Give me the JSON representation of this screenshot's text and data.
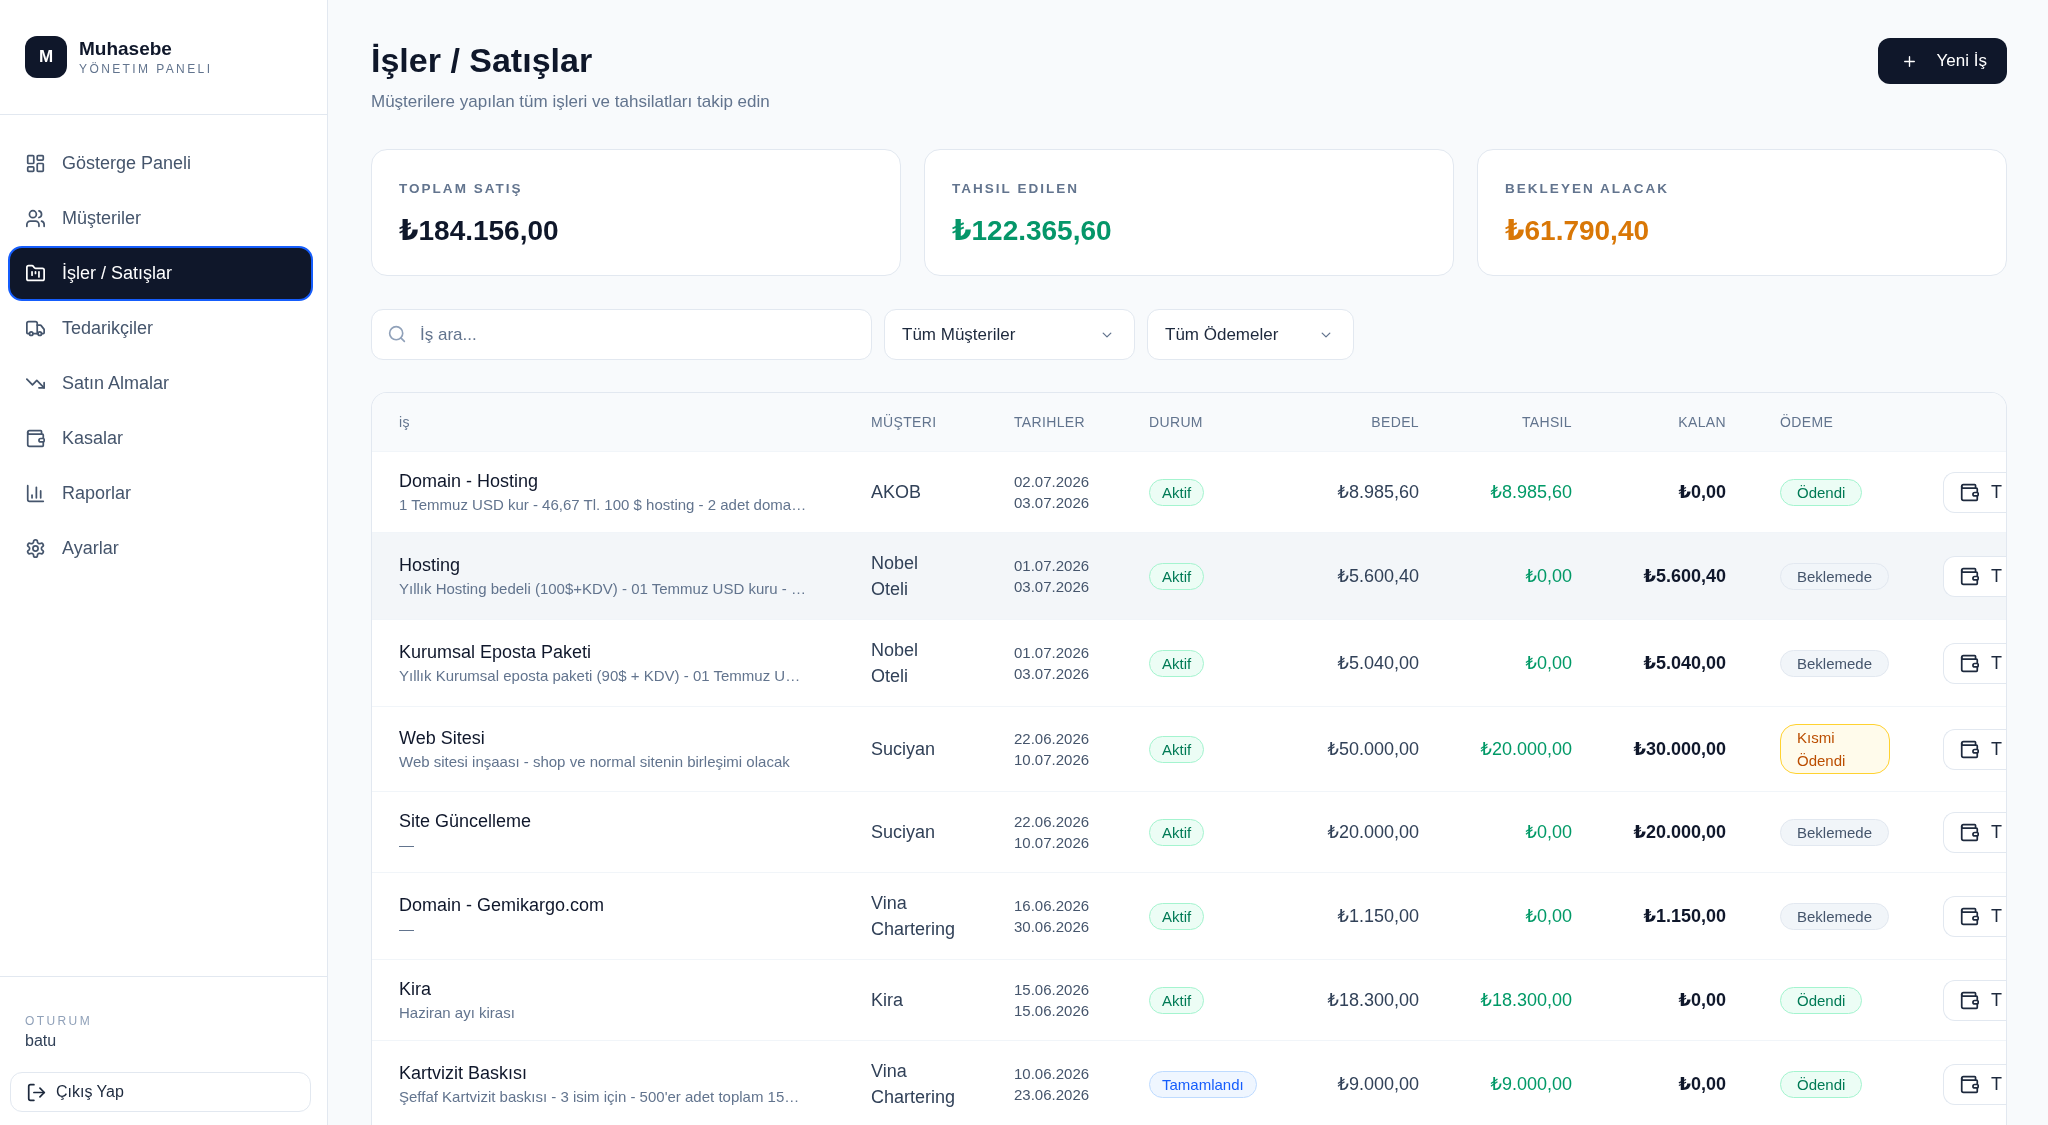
{
  "sidebar": {
    "logo": {
      "mark": "M",
      "title": "Muhasebe",
      "subtitle": "YÖNETIM PANELI"
    },
    "nav": [
      {
        "label": "Gösterge Paneli",
        "selected": false
      },
      {
        "label": "Müşteriler",
        "selected": false
      },
      {
        "label": "İşler / Satışlar",
        "selected": true
      },
      {
        "label": "Tedarikçiler",
        "selected": false
      },
      {
        "label": "Satın Almalar",
        "selected": false
      },
      {
        "label": "Kasalar",
        "selected": false
      },
      {
        "label": "Raporlar",
        "selected": false
      },
      {
        "label": "Ayarlar",
        "selected": false
      }
    ],
    "session": {
      "label": "OTURUM",
      "user": "batu"
    },
    "logout_button": {
      "label": "Çıkış Yap"
    }
  },
  "header": {
    "title": "İşler / Satışlar",
    "subtitle": "Müşterilere yapılan tüm işleri ve tahsilatları takip edin",
    "new_button": {
      "label": "Yeni İş"
    }
  },
  "stats": [
    {
      "label": "TOPLAM SATIŞ",
      "value": "₺184.156,00",
      "color": "#0f172a"
    },
    {
      "label": "TAHSIL EDILEN",
      "value": "₺122.365,60",
      "color": "#059669"
    },
    {
      "label": "BEKLEYEN ALACAK",
      "value": "₺61.790,40",
      "color": "#d97706"
    }
  ],
  "filters": {
    "search": {
      "placeholder": "İş ara..."
    },
    "dropdowns": [
      {
        "value": "Tüm Müşteriler"
      },
      {
        "value": "Tüm Ödemeler"
      }
    ]
  },
  "table": {
    "columns": [
      "iş",
      "MÜŞTERI",
      "TARIHLER",
      "DURUM",
      "BEDEL",
      "TAHSIL",
      "KALAN",
      "ÖDEME"
    ],
    "rows": [
      {
        "title": "Domain - Hosting",
        "description": "1 Temmuz USD kur - 46,67 Tl. 100 $ hosting - 2 adet doma…",
        "customer": "AKOB",
        "dates": [
          "02.07.2026",
          "03.07.2026"
        ],
        "status": {
          "label": "Aktif",
          "kind": "active"
        },
        "amount": "₺8.985,60",
        "collected": "₺8.985,60",
        "remaining": "₺0,00",
        "payment": {
          "label": "Ödendi",
          "kind": "paid"
        },
        "action": {
          "label": "T"
        },
        "highlighted": false
      },
      {
        "title": "Hosting",
        "description": "Yıllık Hosting bedeli (100$+KDV) - 01 Temmuz USD kuru - …",
        "customer": "Nobel Oteli",
        "dates": [
          "01.07.2026",
          "03.07.2026"
        ],
        "status": {
          "label": "Aktif",
          "kind": "active"
        },
        "amount": "₺5.600,40",
        "collected": "₺0,00",
        "remaining": "₺5.600,40",
        "payment": {
          "label": "Beklemede",
          "kind": "pending"
        },
        "action": {
          "label": "T"
        },
        "highlighted": true
      },
      {
        "title": "Kurumsal Eposta Paketi",
        "description": "Yıllık Kurumsal eposta paketi (90$ + KDV) - 01 Temmuz U…",
        "customer": "Nobel Oteli",
        "dates": [
          "01.07.2026",
          "03.07.2026"
        ],
        "status": {
          "label": "Aktif",
          "kind": "active"
        },
        "amount": "₺5.040,00",
        "collected": "₺0,00",
        "remaining": "₺5.040,00",
        "payment": {
          "label": "Beklemede",
          "kind": "pending"
        },
        "action": {
          "label": "T"
        },
        "highlighted": false
      },
      {
        "title": "Web Sitesi",
        "description": "Web sitesi inşaası - shop ve normal sitenin birleşimi olacak",
        "customer": "Suciyan",
        "dates": [
          "22.06.2026",
          "10.07.2026"
        ],
        "status": {
          "label": "Aktif",
          "kind": "active"
        },
        "amount": "₺50.000,00",
        "collected": "₺20.000,00",
        "remaining": "₺30.000,00",
        "payment": {
          "label": "Kısmi Ödendi",
          "kind": "partial"
        },
        "action": {
          "label": "T"
        },
        "highlighted": false
      },
      {
        "title": "Site Güncelleme",
        "description": "—",
        "customer": "Suciyan",
        "dates": [
          "22.06.2026",
          "10.07.2026"
        ],
        "status": {
          "label": "Aktif",
          "kind": "active"
        },
        "amount": "₺20.000,00",
        "collected": "₺0,00",
        "remaining": "₺20.000,00",
        "payment": {
          "label": "Beklemede",
          "kind": "pending"
        },
        "action": {
          "label": "T"
        },
        "highlighted": false
      },
      {
        "title": "Domain - Gemikargo.com",
        "description": "—",
        "customer": "Vina Chartering",
        "dates": [
          "16.06.2026",
          "30.06.2026"
        ],
        "status": {
          "label": "Aktif",
          "kind": "active"
        },
        "amount": "₺1.150,00",
        "collected": "₺0,00",
        "remaining": "₺1.150,00",
        "payment": {
          "label": "Beklemede",
          "kind": "pending"
        },
        "action": {
          "label": "T"
        },
        "highlighted": false
      },
      {
        "title": "Kira",
        "description": "Haziran ayı kirası",
        "customer": "Kira",
        "dates": [
          "15.06.2026",
          "15.06.2026"
        ],
        "status": {
          "label": "Aktif",
          "kind": "active"
        },
        "amount": "₺18.300,00",
        "collected": "₺18.300,00",
        "remaining": "₺0,00",
        "payment": {
          "label": "Ödendi",
          "kind": "paid"
        },
        "action": {
          "label": "T"
        },
        "highlighted": false
      },
      {
        "title": "Kartvizit Baskısı",
        "description": "Şeffaf Kartvizit baskısı - 3 isim için - 500'er adet toplam 15…",
        "customer": "Vina Chartering",
        "dates": [
          "10.06.2026",
          "23.06.2026"
        ],
        "status": {
          "label": "Tamamlandı",
          "kind": "completed"
        },
        "amount": "₺9.000,00",
        "collected": "₺9.000,00",
        "remaining": "₺0,00",
        "payment": {
          "label": "Ödendi",
          "kind": "paid"
        },
        "action": {
          "label": "T"
        },
        "highlighted": false
      }
    ]
  }
}
